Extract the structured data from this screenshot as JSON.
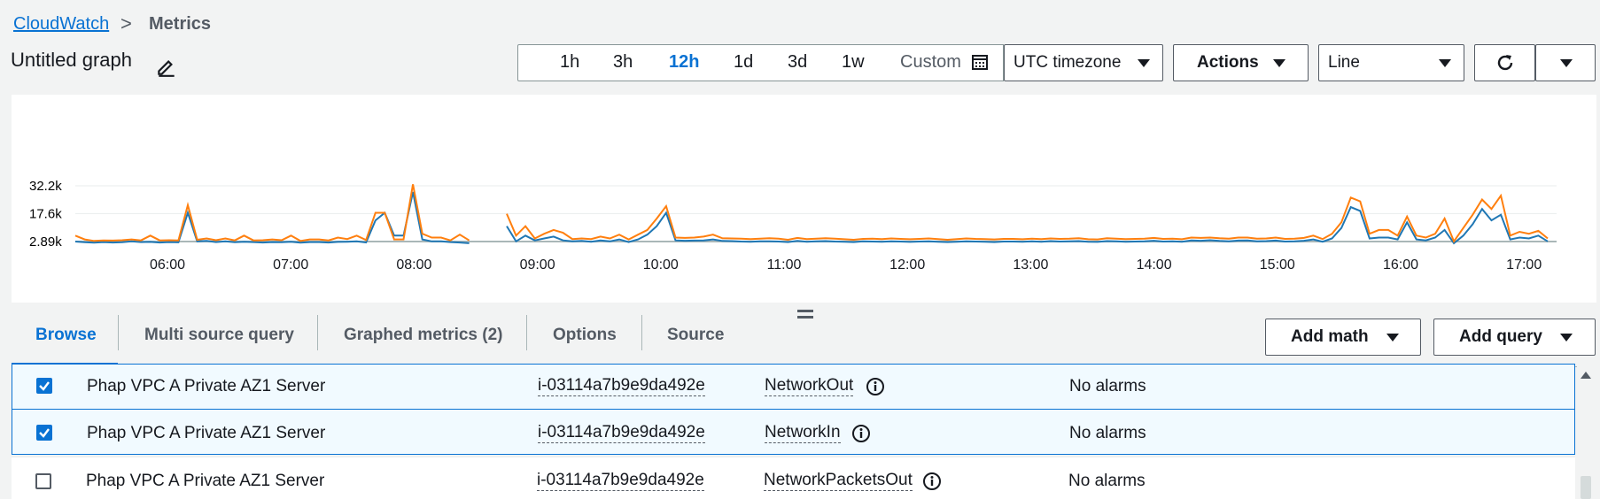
{
  "breadcrumb": {
    "root": "CloudWatch",
    "separator": ">",
    "current": "Metrics"
  },
  "graph": {
    "title": "Untitled graph"
  },
  "time_range": {
    "options": [
      "1h",
      "3h",
      "12h",
      "1d",
      "3d",
      "1w"
    ],
    "active": "12h",
    "custom_label": "Custom"
  },
  "toolbar": {
    "timezone": "UTC timezone",
    "actions": "Actions",
    "chart_type": "Line"
  },
  "colors": {
    "accent": "#0972d3",
    "series_blue": "#1f77b4",
    "series_orange": "#ff7f0e"
  },
  "chart_data": {
    "type": "line",
    "yticks": [
      "32.2k",
      "17.6k",
      "2.89k"
    ],
    "ytick_values": [
      32200,
      17600,
      2890
    ],
    "xticks": [
      "06:00",
      "07:00",
      "08:00",
      "09:00",
      "10:00",
      "11:00",
      "12:00",
      "13:00",
      "14:00",
      "15:00",
      "16:00",
      "17:00"
    ],
    "x_range": [
      "05:15",
      "17:15"
    ],
    "grid": true,
    "series": [
      {
        "values": [
          2890,
          2500,
          2300,
          2600,
          2400,
          2500,
          3000,
          2600,
          2700,
          2400,
          2600,
          2500,
          18000,
          3000,
          3200,
          2600,
          3000,
          2500,
          2800,
          2600,
          2400,
          2600,
          2500,
          2800,
          2300,
          2600,
          2600,
          2400,
          2700,
          2800,
          3000,
          2400,
          14000,
          18000,
          6000,
          6000,
          29000,
          4000,
          3000,
          3000,
          2600,
          2400,
          2000,
          null,
          null,
          null,
          11000,
          3000,
          6000,
          3500,
          4500,
          5500,
          3500,
          3000,
          3200,
          2800,
          3500,
          3000,
          4000,
          2600,
          4000,
          6500,
          11000,
          18000,
          3500,
          3300,
          3400,
          3500,
          4000,
          3200,
          3100,
          2900,
          2800,
          3000,
          3000,
          2900,
          2600,
          3200,
          2800,
          3000,
          3100,
          2900,
          2800,
          2600,
          3000,
          2900,
          2800,
          3000,
          2900,
          2700,
          2900,
          3000,
          2800,
          2600,
          2800,
          3000,
          2900,
          2800,
          2600,
          2900,
          2900,
          2800,
          3000,
          2800,
          3100,
          2900,
          3000,
          3100,
          2800,
          2700,
          3100,
          3000,
          2800,
          2900,
          3000,
          3300,
          2900,
          3000,
          2800,
          3500,
          3300,
          3600,
          3200,
          3000,
          3400,
          3500,
          3000,
          3100,
          3400,
          2900,
          3000,
          3300,
          4000,
          2800,
          4500,
          10000,
          21000,
          19000,
          4500,
          5000,
          5000,
          4000,
          13000,
          4000,
          3500,
          5000,
          9000,
          2000,
          6000,
          12000,
          20000,
          14000,
          17000,
          4000,
          5000,
          4500,
          6000,
          3000
        ]
      },
      {
        "values": [
          6000,
          4000,
          3200,
          3500,
          3400,
          3600,
          4000,
          3500,
          6000,
          3500,
          3600,
          3500,
          22000,
          3800,
          4500,
          3600,
          4500,
          3500,
          6000,
          3500,
          3600,
          4000,
          3600,
          6000,
          3200,
          4000,
          4000,
          3500,
          5000,
          4200,
          6000,
          3700,
          18000,
          18000,
          4000,
          4000,
          33000,
          7000,
          5000,
          5000,
          3500,
          6500,
          3500,
          null,
          null,
          null,
          17500,
          6000,
          11000,
          4500,
          7000,
          9000,
          7500,
          4200,
          4500,
          4200,
          5500,
          4500,
          6500,
          4000,
          6500,
          9000,
          15000,
          21500,
          5000,
          4800,
          5000,
          5500,
          6500,
          4600,
          4500,
          4400,
          4200,
          4400,
          4600,
          4400,
          3800,
          4800,
          4200,
          4400,
          4600,
          4400,
          4100,
          3800,
          4300,
          4400,
          4200,
          4500,
          4300,
          4100,
          4300,
          4500,
          4200,
          3800,
          4200,
          4500,
          4300,
          4200,
          4000,
          4300,
          4300,
          4100,
          4400,
          4200,
          4500,
          4300,
          4400,
          4600,
          4100,
          4000,
          4600,
          4400,
          4200,
          4300,
          4400,
          4800,
          4300,
          4400,
          4100,
          5000,
          4800,
          5000,
          4600,
          4400,
          5000,
          5000,
          4400,
          4500,
          5000,
          4300,
          4400,
          4800,
          6000,
          4200,
          7000,
          13000,
          26000,
          24000,
          7000,
          9000,
          9000,
          6000,
          16000,
          6000,
          5000,
          7000,
          15000,
          3000,
          10000,
          17000,
          25000,
          20000,
          27000,
          6000,
          8000,
          7000,
          8500,
          4500
        ]
      }
    ]
  },
  "tabs": {
    "browse": "Browse",
    "multi": "Multi source query",
    "graphed": "Graphed metrics (2)",
    "options": "Options",
    "source": "Source"
  },
  "buttons": {
    "add_math": "Add math",
    "add_query": "Add query"
  },
  "rows": [
    {
      "checked": true,
      "name": "Phap VPC A Private AZ1 Server",
      "instance": "i-03114a7b9e9da492e",
      "metric": "NetworkOut",
      "alarms": "No alarms"
    },
    {
      "checked": true,
      "name": "Phap VPC A Private AZ1 Server",
      "instance": "i-03114a7b9e9da492e",
      "metric": "NetworkIn",
      "alarms": "No alarms"
    },
    {
      "checked": false,
      "name": "Phap VPC A Private AZ1 Server",
      "instance": "i-03114a7b9e9da492e",
      "metric": "NetworkPacketsOut",
      "alarms": "No alarms"
    }
  ],
  "icons": {
    "edit": "pencil-icon",
    "calendar": "calendar-icon",
    "refresh": "refresh-icon",
    "info": "info-icon",
    "check": "checkmark-icon"
  }
}
